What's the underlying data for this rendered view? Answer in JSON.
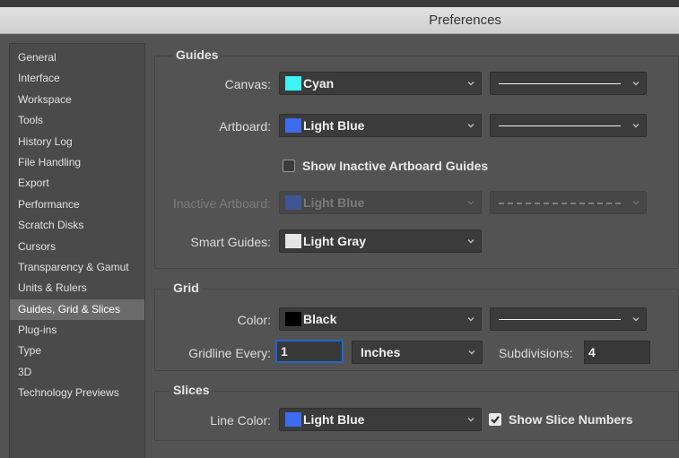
{
  "window": {
    "title": "Preferences"
  },
  "sidebar": {
    "items": [
      {
        "label": "General"
      },
      {
        "label": "Interface"
      },
      {
        "label": "Workspace"
      },
      {
        "label": "Tools"
      },
      {
        "label": "History Log"
      },
      {
        "label": "File Handling"
      },
      {
        "label": "Export"
      },
      {
        "label": "Performance"
      },
      {
        "label": "Scratch Disks"
      },
      {
        "label": "Cursors"
      },
      {
        "label": "Transparency & Gamut"
      },
      {
        "label": "Units & Rulers"
      },
      {
        "label": "Guides, Grid & Slices",
        "selected": true
      },
      {
        "label": "Plug-ins"
      },
      {
        "label": "Type"
      },
      {
        "label": "3D"
      },
      {
        "label": "Technology Previews"
      }
    ]
  },
  "guides": {
    "title": "Guides",
    "canvas": {
      "label": "Canvas:",
      "color_name": "Cyan",
      "swatch": "#3df3f5",
      "line_style": "solid"
    },
    "artboard": {
      "label": "Artboard:",
      "color_name": "Light Blue",
      "swatch": "#3d6cf0",
      "line_style": "solid"
    },
    "show_inactive": {
      "label": "Show Inactive Artboard Guides",
      "checked": false
    },
    "inactive_artboard": {
      "label": "Inactive Artboard:",
      "color_name": "Light Blue",
      "swatch": "#3d6cf0",
      "line_style": "dashed",
      "disabled": true
    },
    "smart_guides": {
      "label": "Smart Guides:",
      "color_name": "Light Gray",
      "swatch": "#e6e6e6"
    }
  },
  "grid": {
    "title": "Grid",
    "color": {
      "label": "Color:",
      "color_name": "Black",
      "swatch": "#000000",
      "line_style": "solid"
    },
    "gridline_every": {
      "label": "Gridline Every:",
      "value": "1",
      "unit": "Inches"
    },
    "subdivisions": {
      "label": "Subdivisions:",
      "value": "4"
    }
  },
  "slices": {
    "title": "Slices",
    "line_color": {
      "label": "Line Color:",
      "color_name": "Light Blue",
      "swatch": "#3d6cf0"
    },
    "show_numbers": {
      "label": "Show Slice Numbers",
      "checked": true
    }
  },
  "colors": {
    "panel_bg": "#535353",
    "selected_item": "#6b6b6b",
    "focus_ring": "#2a63c4"
  }
}
